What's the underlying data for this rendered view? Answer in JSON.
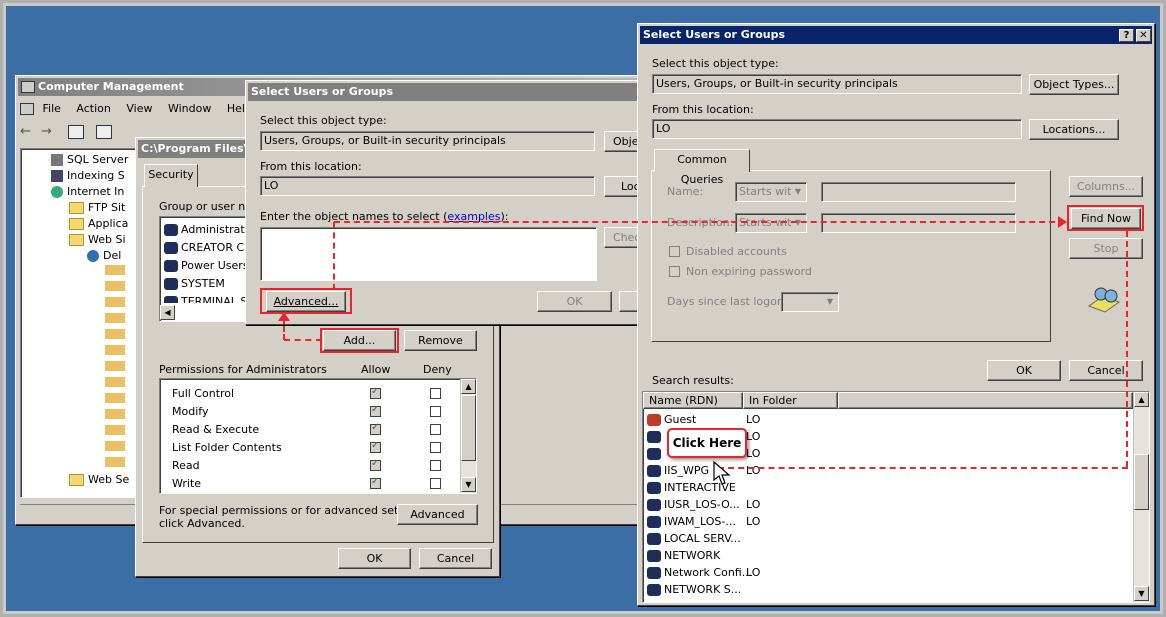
{
  "computer_management": {
    "title": "Computer Management",
    "menu": [
      "File",
      "Action",
      "View",
      "Window",
      "Help"
    ],
    "tree": [
      "SQL Server",
      "Indexing S",
      "Internet In",
      "FTP Sit",
      "Applica",
      "Web Si",
      "Del",
      "Web Se"
    ]
  },
  "props_window": {
    "title": "C:\\Program Files\\O",
    "tab": "Security",
    "group_label": "Group or user nam",
    "users": [
      "Administrator",
      "CREATOR C",
      "Power Users",
      "SYSTEM",
      "TERMINAL S"
    ],
    "add_label": "Add...",
    "remove_label": "Remove",
    "perm_header": "Permissions for Administrators",
    "allow_header": "Allow",
    "deny_header": "Deny",
    "permissions": [
      "Full Control",
      "Modify",
      "Read & Execute",
      "List Folder Contents",
      "Read",
      "Write"
    ],
    "special_text_1": "For special permissions or for advanced settings,",
    "special_text_2": "click Advanced.",
    "advanced_label": "Advanced",
    "ok_label": "OK",
    "cancel_label": "Cancel"
  },
  "select_small": {
    "title": "Select Users or Groups",
    "object_type_label": "Select this object type:",
    "object_type_value": "Users, Groups, or Built-in security principals",
    "object_types_btn": "Objec",
    "location_label": "From this location:",
    "location_value": "LO",
    "locations_btn": "Loc",
    "names_label": "Enter the object names to select (",
    "examples_link": "examples",
    "names_label_end": "):",
    "check_btn": "Chec",
    "advanced_btn": "Advanced...",
    "ok_label": "OK"
  },
  "select_adv": {
    "title": "Select Users or Groups",
    "help_btn": "?",
    "close_btn": "✕",
    "object_type_label": "Select this object type:",
    "object_type_value": "Users, Groups, or Built-in security principals",
    "object_types_btn": "Object Types...",
    "location_label": "From this location:",
    "location_value": "LO",
    "locations_btn": "Locations...",
    "common_queries_tab": "Common Queries",
    "name_label": "Name:",
    "name_op": "Starts with",
    "desc_label": "Description:",
    "desc_op": "Starts with",
    "disabled_accounts": "Disabled accounts",
    "non_expiring": "Non expiring password",
    "days_label": "Days since last logon:",
    "columns_btn": "Columns...",
    "find_now_btn": "Find Now",
    "stop_btn": "Stop",
    "ok_label": "OK",
    "cancel_label": "Cancel",
    "search_results_label": "Search results:",
    "col_name": "Name (RDN)",
    "col_folder": "In Folder",
    "results": [
      {
        "name": "Guest",
        "folder": "LO"
      },
      {
        "name": "",
        "folder": "LO"
      },
      {
        "name": "",
        "folder": "LO"
      },
      {
        "name": "IIS_WPG",
        "folder": "LO"
      },
      {
        "name": "INTERACTIVE",
        "folder": ""
      },
      {
        "name": "IUSR_LOS-O...",
        "folder": "LO"
      },
      {
        "name": "IWAM_LOS-...",
        "folder": "LO"
      },
      {
        "name": "LOCAL SERV...",
        "folder": ""
      },
      {
        "name": "NETWORK",
        "folder": ""
      },
      {
        "name": "Network Confi...",
        "folder": "LO"
      },
      {
        "name": "NETWORK S...",
        "folder": ""
      }
    ]
  },
  "callout": {
    "text": "Click Here"
  },
  "colors": {
    "annotation": "#e8262a",
    "title_active": "#0a246a",
    "desktop": "#3a6ea5"
  }
}
